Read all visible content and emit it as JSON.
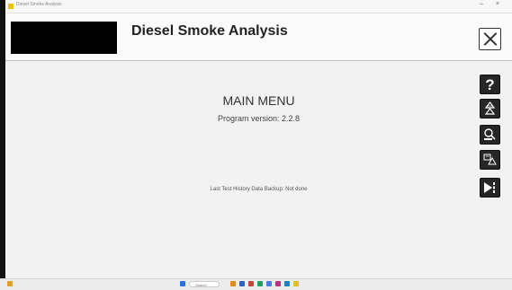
{
  "window": {
    "title": "Diesel Smoke Analysis"
  },
  "header": {
    "title": "Diesel Smoke Analysis"
  },
  "main": {
    "title": "MAIN MENU",
    "version": "Program version: 2.2.8",
    "backup_status": "Last Test History Data Backup: Not done"
  },
  "toolbar": {
    "help_label": "?",
    "icons": [
      "help-icon",
      "compare-icon",
      "search-icon",
      "history-icon",
      "export-icon"
    ]
  },
  "taskbar": {
    "search_placeholder": "Search"
  },
  "colors": {
    "background": "#f2f2f2",
    "button": "#262626",
    "accent_start": "#e6c200"
  }
}
